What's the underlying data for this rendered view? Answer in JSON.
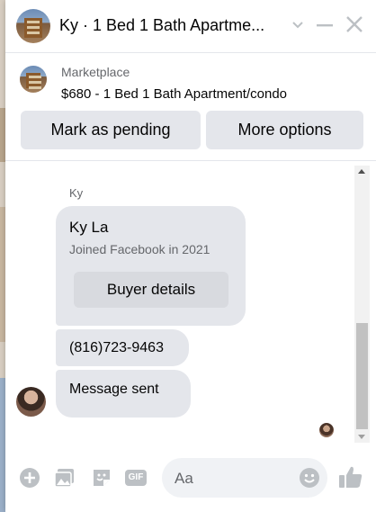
{
  "header": {
    "title": "Ky · 1 Bed 1 Bath Apartme..."
  },
  "marketplace": {
    "label": "Marketplace",
    "listing": "$680 - 1 Bed 1 Bath Apartment/condo",
    "pending_button": "Mark as pending",
    "more_button": "More options"
  },
  "conversation": {
    "sender_name": "Ky",
    "card": {
      "name": "Ky La",
      "joined": "Joined Facebook in 2021",
      "buyer_button": "Buyer details"
    },
    "messages": [
      "(816)723-9463",
      "Message sent"
    ]
  },
  "composer": {
    "placeholder": "Aa",
    "gif_label": "GIF"
  },
  "colors": {
    "accent": "#bcc0c4",
    "bubble": "#e4e6eb",
    "secondary_text": "#65676b"
  },
  "icons": [
    "chevron-down-icon",
    "minimize-icon",
    "close-icon",
    "plus-circle-icon",
    "photo-icon",
    "sticker-icon",
    "gif-icon",
    "emoji-icon",
    "thumbs-up-icon"
  ]
}
